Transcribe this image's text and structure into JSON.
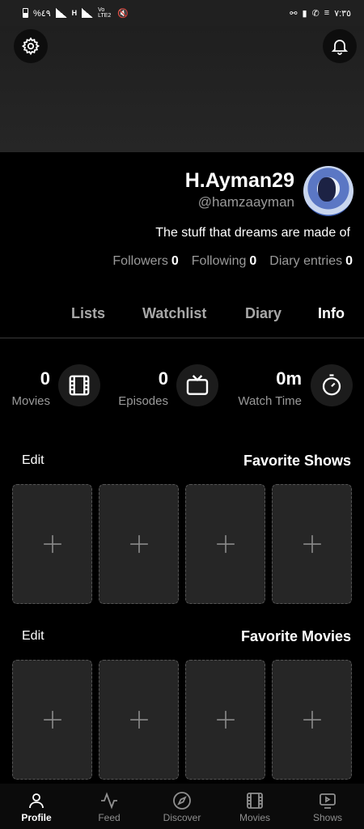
{
  "status_bar": {
    "left_text": "%٤٩",
    "network_badge": "H",
    "volte": "Vo LTE2",
    "time": "٧:٣٥"
  },
  "header": {
    "settings_icon": "gear-icon",
    "notifications_icon": "bell-icon"
  },
  "profile": {
    "username": "H.Ayman29",
    "handle": "@hamzaayman",
    "bio": "The stuff that dreams are made of",
    "stats": [
      {
        "label": "Followers",
        "value": "0"
      },
      {
        "label": "Following",
        "value": "0"
      },
      {
        "label": "Diary entries",
        "value": "0"
      }
    ]
  },
  "tabs": [
    {
      "label": "Lists",
      "active": false
    },
    {
      "label": "Watchlist",
      "active": false
    },
    {
      "label": "Diary",
      "active": false
    },
    {
      "label": "Info",
      "active": true
    }
  ],
  "counters": [
    {
      "value": "0",
      "label": "Movies",
      "icon": "film-icon"
    },
    {
      "value": "0",
      "label": "Episodes",
      "icon": "tv-icon"
    },
    {
      "value": "0m",
      "label": "Watch Time",
      "icon": "stopwatch-icon"
    }
  ],
  "favorite_shows": {
    "title": "Favorite Shows",
    "edit_label": "Edit",
    "slots": 4
  },
  "favorite_movies": {
    "title": "Favorite Movies",
    "edit_label": "Edit",
    "slots": 4
  },
  "bottom_nav": [
    {
      "label": "Profile",
      "icon": "person-icon",
      "active": true
    },
    {
      "label": "Feed",
      "icon": "activity-icon",
      "active": false
    },
    {
      "label": "Discover",
      "icon": "compass-icon",
      "active": false
    },
    {
      "label": "Movies",
      "icon": "film-icon",
      "active": false
    },
    {
      "label": "Shows",
      "icon": "tv-play-icon",
      "active": false
    }
  ],
  "colors": {
    "background": "#000000",
    "muted_text": "#9a9a9a",
    "card": "#262626"
  }
}
